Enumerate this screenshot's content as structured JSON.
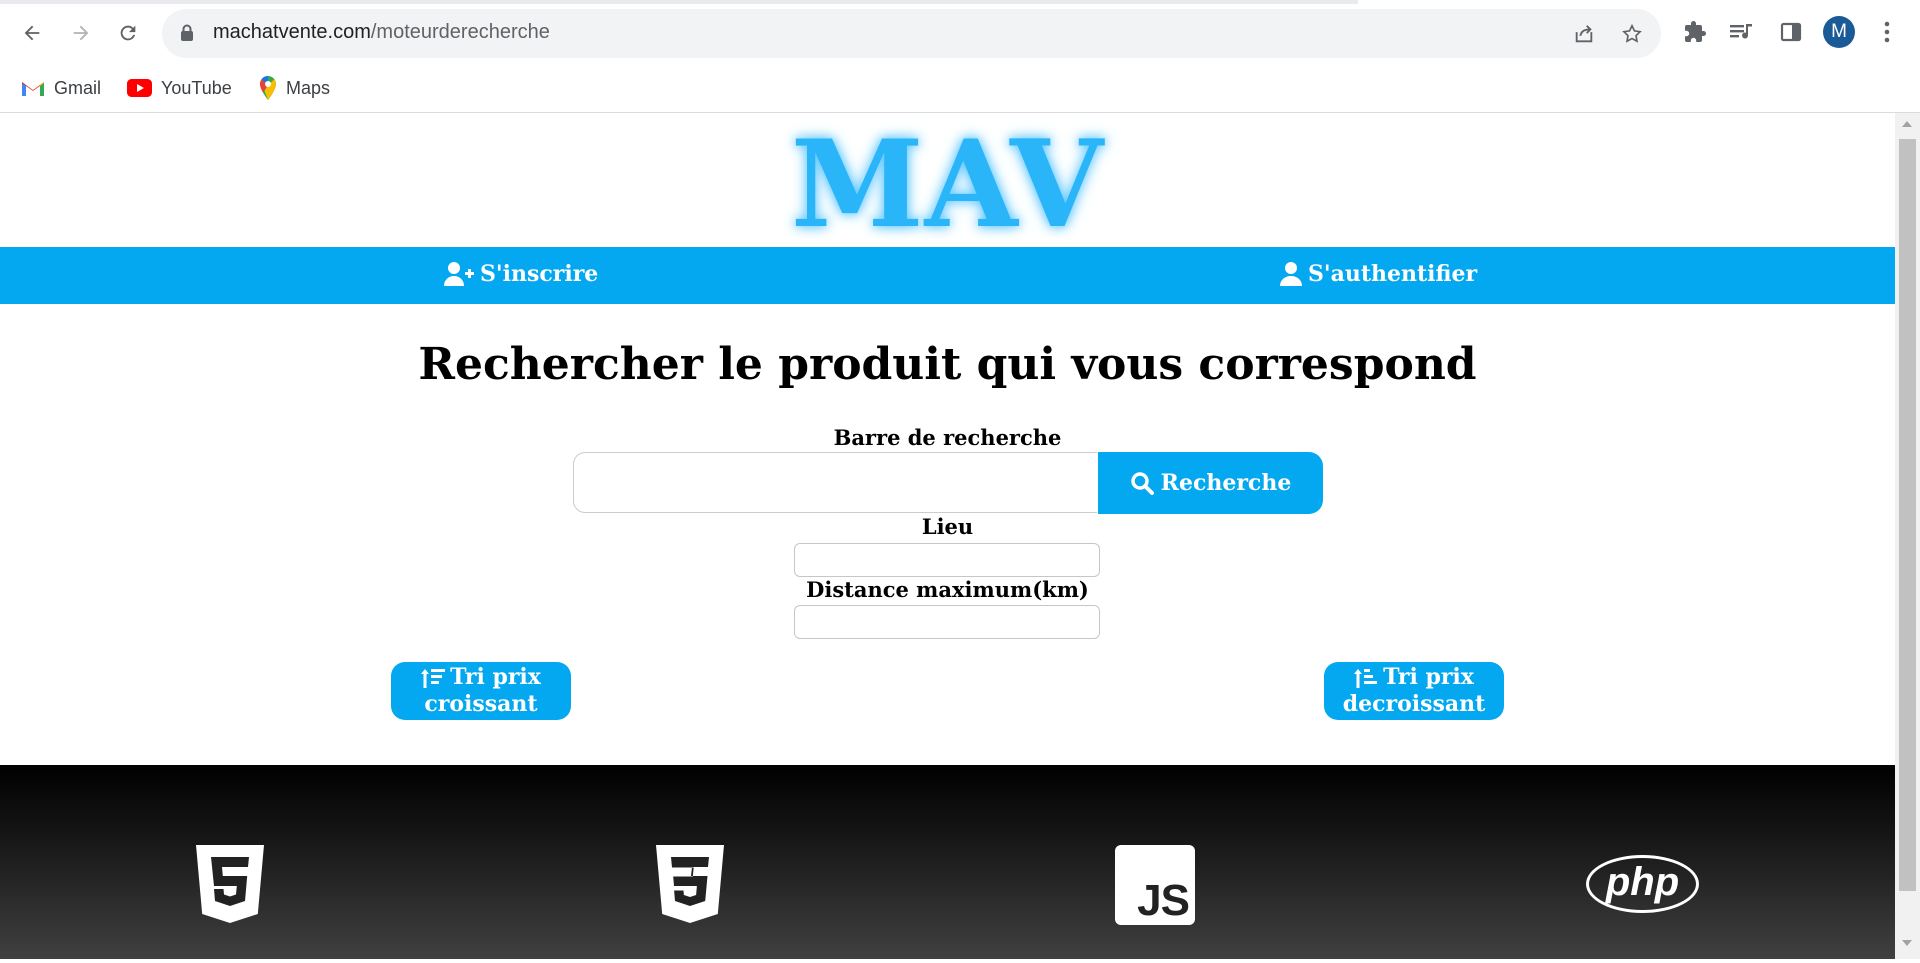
{
  "browser": {
    "url_domain": "machatvente.com",
    "url_path": "/moteurderecherche",
    "profile_initial": "M",
    "bookmarks": [
      {
        "label": "Gmail",
        "icon": "gmail-icon"
      },
      {
        "label": "YouTube",
        "icon": "youtube-icon"
      },
      {
        "label": "Maps",
        "icon": "maps-icon"
      }
    ]
  },
  "site": {
    "logo": "MAV",
    "nav": {
      "signup": "S'inscrire",
      "login": "S'authentifier"
    }
  },
  "search": {
    "title": "Rechercher le produit qui vous correspond",
    "bar_label": "Barre de recherche",
    "bar_value": "",
    "button": "Recherche",
    "place_label": "Lieu",
    "place_value": "",
    "distance_label": "Distance maximum(km)",
    "distance_value": ""
  },
  "sort": {
    "asc_line1": "Tri prix",
    "asc_line2": "croissant",
    "desc_line1": "Tri prix",
    "desc_line2": "decroissant"
  },
  "footer": {
    "icons": [
      "html5-icon",
      "css3-icon",
      "javascript-icon",
      "php-icon"
    ],
    "js_text": "JS",
    "php_text": "php"
  },
  "colors": {
    "accent": "#04a8f0",
    "logo": "#29b5f7",
    "footer_top": "#000000",
    "footer_bottom": "#424242"
  }
}
